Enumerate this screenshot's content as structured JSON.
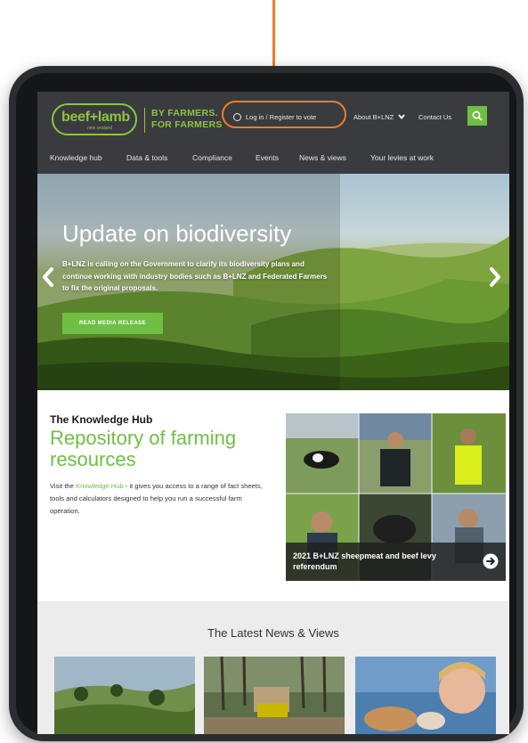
{
  "header": {
    "logo_text": "beef+lamb",
    "logo_subtext": "new zealand",
    "tagline_line1": "BY FARMERS.",
    "tagline_line2": "FOR FARMERS",
    "login_label": "Log in / Register to vote",
    "about_label": "About B+LNZ",
    "contact_label": "Contact Us"
  },
  "nav": {
    "items": [
      "Knowledge hub",
      "Data & tools",
      "Compliance",
      "Events",
      "News & views",
      "Your levies at work"
    ]
  },
  "hero": {
    "title": "Update on biodiversity",
    "text": "B+LNZ is calling on the Government to clarify its biodiversity plans and continue working with industry bodies such as B+LNZ and Federated Farmers to fix the original proposals.",
    "button_label": "READ MEDIA RELEASE"
  },
  "knowledge_hub": {
    "eyebrow": "The Knowledge Hub",
    "title": "Repository of farming resources",
    "body_prefix": "Visit the ",
    "body_link": "Knowledge Hub",
    "body_suffix": " - it gives you access to a range of fact sheets, tools and calculators designed to help you run a successful farm operation.",
    "caption": "2021 B+LNZ sheepmeat and beef levy referendum"
  },
  "news": {
    "title": "The Latest News & Views"
  },
  "colors": {
    "brand_green": "#6fbf44",
    "logo_green": "#8cc63f",
    "header_bg": "#3a3b3f",
    "annotation_orange": "#ef7d22"
  }
}
